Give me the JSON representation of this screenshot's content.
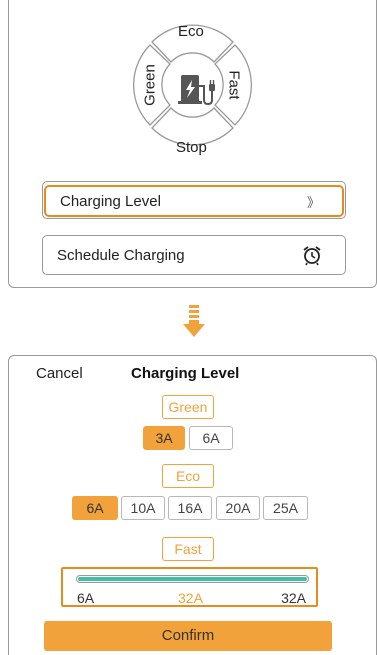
{
  "colors": {
    "accent": "#f2a23a",
    "selected_border": "#e88b1f",
    "slider_fill": "#3fbfa4",
    "icon": "#555555"
  },
  "dial": {
    "top_label": "Eco",
    "left_label": "Green",
    "right_label": "Fast",
    "bottom_label": "Stop",
    "center_icon": "ev-charger-icon"
  },
  "menu": {
    "charging_level": {
      "label": "Charging Level",
      "chevron": "》"
    },
    "schedule_charging": {
      "label": "Schedule Charging",
      "icon": "alarm-clock-icon"
    }
  },
  "transition_icon": "down-arrow-icon",
  "dialog": {
    "cancel_label": "Cancel",
    "title": "Charging Level",
    "green": {
      "label": "Green",
      "options": [
        "3A",
        "6A"
      ],
      "selected": "3A"
    },
    "eco": {
      "label": "Eco",
      "options": [
        "6A",
        "10A",
        "16A",
        "20A",
        "25A"
      ],
      "selected": "6A"
    },
    "fast": {
      "label": "Fast",
      "slider": {
        "min_label": "6A",
        "current_label": "32A",
        "max_label": "32A",
        "fill_fraction": 1.0
      }
    },
    "confirm_label": "Confirm"
  }
}
